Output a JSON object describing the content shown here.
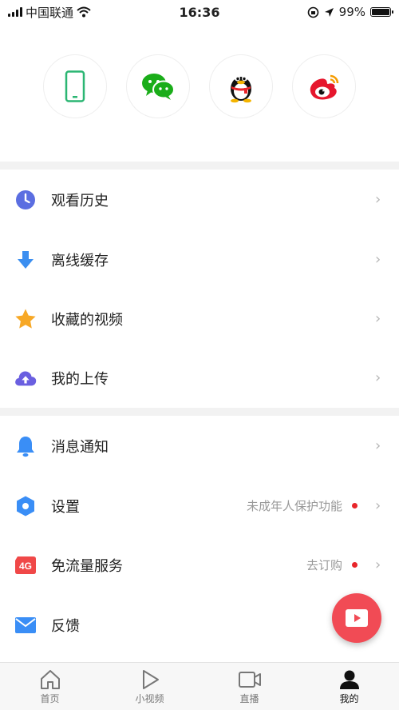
{
  "status_bar": {
    "carrier": "中国联通",
    "time": "16:36",
    "battery_percent": "99%",
    "battery_level": 0.99
  },
  "share_buttons": [
    {
      "icon": "phone-icon",
      "color": "#2bb673"
    },
    {
      "icon": "wechat-icon",
      "color": "#1aad19"
    },
    {
      "icon": "qq-icon",
      "color": "#000000"
    },
    {
      "icon": "weibo-icon",
      "color": "#e6162d"
    }
  ],
  "menu": {
    "history": {
      "label": "观看历史",
      "icon": "clock-icon",
      "color": "#5b6ee1"
    },
    "offline": {
      "label": "离线缓存",
      "icon": "download-icon",
      "color": "#3b8ef0"
    },
    "favorites": {
      "label": "收藏的视频",
      "icon": "star-icon",
      "color": "#f7a826"
    },
    "uploads": {
      "label": "我的上传",
      "icon": "cloud-upload-icon",
      "color": "#6a5fe0"
    },
    "messages": {
      "label": "消息通知",
      "icon": "bell-icon",
      "color": "#3a8ef6"
    },
    "settings": {
      "label": "设置",
      "icon": "hexagon-settings-icon",
      "color": "#3a8ef6",
      "extra": "未成年人保护功能"
    },
    "data_service": {
      "label": "免流量服务",
      "icon": "4g-icon",
      "icon_text": "4G",
      "color": "#f04848",
      "extra": "去订购"
    },
    "feedback": {
      "label": "反馈",
      "icon": "mail-icon",
      "color": "#3a8ef6"
    }
  },
  "chevron": "›",
  "fab": {
    "icon": "play-video-icon",
    "color": "#f14b55"
  },
  "tabs": [
    {
      "label": "首页",
      "icon": "home-icon"
    },
    {
      "label": "小视频",
      "icon": "play-icon"
    },
    {
      "label": "直播",
      "icon": "camera-icon"
    },
    {
      "label": "我的",
      "icon": "person-icon",
      "active": true
    }
  ]
}
